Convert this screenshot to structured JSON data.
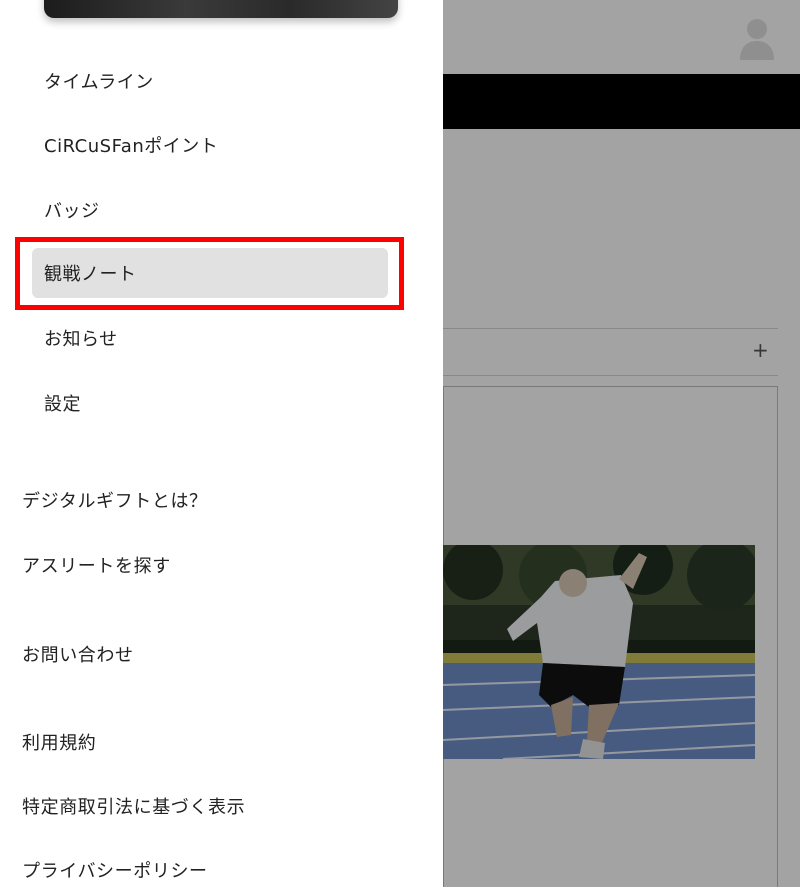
{
  "drawer": {
    "menu": [
      {
        "label": "タイムライン"
      },
      {
        "label": "CiRCuSFanポイント"
      },
      {
        "label": "バッジ"
      },
      {
        "label": "観戦ノート",
        "active": true
      },
      {
        "label": "お知らせ"
      },
      {
        "label": "設定"
      }
    ],
    "links": [
      {
        "label": "デジタルギフトとは？"
      },
      {
        "label": "アスリートを探す"
      },
      {
        "label": "お問い合わせ"
      },
      {
        "label": "利用規約"
      },
      {
        "label": "特定商取引法に基づく表示"
      },
      {
        "label": "プライバシーポリシー"
      }
    ]
  },
  "background": {
    "expand_icon": "+",
    "avatar_icon": "user-avatar-icon",
    "photo": "athlete-sprint-start-photo"
  },
  "colors": {
    "highlight": "#ff0000",
    "active_item_bg": "#e1e1e1",
    "overlay": "rgba(0,0,0,0.36)"
  }
}
